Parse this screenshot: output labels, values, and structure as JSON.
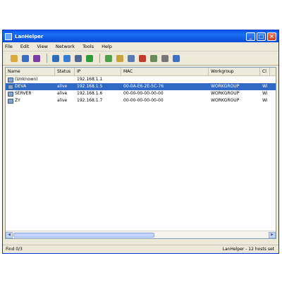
{
  "window": {
    "title": "LanHelper"
  },
  "menu": [
    "File",
    "Edit",
    "View",
    "Network",
    "Tools",
    "Help"
  ],
  "toolbar": {
    "buttons": [
      {
        "icon": "open-folder-icon",
        "color": "#d9a93b"
      },
      {
        "icon": "save-icon",
        "color": "#3a6bc7"
      },
      {
        "icon": "print-icon",
        "color": "#7a3aa8"
      },
      {
        "icon": "network-globe-icon",
        "color": "#2c6fb8"
      },
      {
        "icon": "scan-network-icon",
        "color": "#3a7bd5"
      },
      {
        "icon": "computer-icon",
        "color": "#4c6a92"
      },
      {
        "icon": "green-arrow-icon",
        "color": "#2f9a3a"
      },
      {
        "icon": "document-icon",
        "color": "#4f9e4a"
      },
      {
        "icon": "copy-icon",
        "color": "#c8a23c"
      },
      {
        "icon": "shared-icon",
        "color": "#5a79b5"
      },
      {
        "icon": "help-icon",
        "color": "#c23a2a"
      },
      {
        "icon": "monitor-icon",
        "color": "#6b8a5a"
      },
      {
        "icon": "speaker-icon",
        "color": "#777777"
      },
      {
        "icon": "about-icon",
        "color": "#3d6fc4"
      }
    ]
  },
  "list": {
    "columns": [
      "Name",
      "Status",
      "IP",
      "MAC",
      "Workgroup",
      "Cl"
    ],
    "rows": [
      {
        "name": "(Unknown)",
        "status": "",
        "ip": "192.168.1.1",
        "mac": "",
        "workgroup": "",
        "extra": "",
        "selected": false
      },
      {
        "name": "DEVA",
        "status": "alive",
        "ip": "192.168.1.5",
        "mac": "00-0A-E6-2E-5C-76",
        "workgroup": "WORKGROUP",
        "extra": "Wi",
        "selected": true
      },
      {
        "name": "SERVER",
        "status": "alive",
        "ip": "192.168.1.6",
        "mac": "00-00-00-00-00-00",
        "workgroup": "WORKGROUP",
        "extra": "Wi",
        "selected": false
      },
      {
        "name": "ZY",
        "status": "alive",
        "ip": "192.168.1.7",
        "mac": "00-00-00-00-00-00",
        "workgroup": "WORKGROUP",
        "extra": "Wi",
        "selected": false
      }
    ]
  },
  "status": {
    "left": "Find 0/3",
    "right": "LanHelper - 12 hosts set"
  }
}
